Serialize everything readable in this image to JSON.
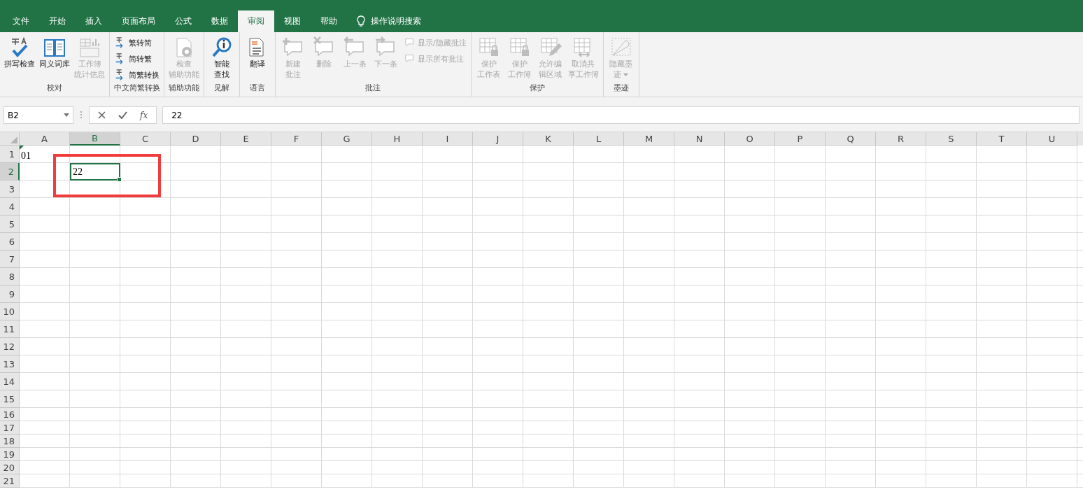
{
  "tabs": [
    {
      "label": "文件",
      "selected": false
    },
    {
      "label": "开始",
      "selected": false
    },
    {
      "label": "插入",
      "selected": false
    },
    {
      "label": "页面布局",
      "selected": false
    },
    {
      "label": "公式",
      "selected": false
    },
    {
      "label": "数据",
      "selected": false
    },
    {
      "label": "审阅",
      "selected": true
    },
    {
      "label": "视图",
      "selected": false
    },
    {
      "label": "帮助",
      "selected": false
    }
  ],
  "tell_me": {
    "placeholder": "操作说明搜索"
  },
  "ribbon_groups": [
    {
      "label": "校对",
      "items": [
        {
          "kind": "large",
          "label": "拼写检查",
          "disabled": false
        },
        {
          "kind": "large",
          "label": "同义词库",
          "disabled": false
        },
        {
          "kind": "large",
          "label": "工作簿统计信息",
          "disabled": true
        }
      ]
    },
    {
      "label": "中文简繁转换",
      "items": [
        {
          "kind": "small",
          "label": "繁转简",
          "disabled": false
        },
        {
          "kind": "small",
          "label": "简转繁",
          "disabled": false
        },
        {
          "kind": "small",
          "label": "简繁转换",
          "disabled": false
        }
      ]
    },
    {
      "label": "辅助功能",
      "items": [
        {
          "kind": "large",
          "label": "检查辅助功能",
          "disabled": true
        }
      ]
    },
    {
      "label": "见解",
      "items": [
        {
          "kind": "large",
          "label": "智能查找",
          "disabled": false
        }
      ]
    },
    {
      "label": "语言",
      "items": [
        {
          "kind": "large",
          "label": "翻译",
          "disabled": false
        }
      ]
    },
    {
      "label": "批注",
      "items": [
        {
          "kind": "large",
          "label": "新建批注",
          "disabled": true
        },
        {
          "kind": "large",
          "label": "删除",
          "disabled": true
        },
        {
          "kind": "large",
          "label": "上一条",
          "disabled": true
        },
        {
          "kind": "large",
          "label": "下一条",
          "disabled": true
        },
        {
          "kind": "small",
          "label": "显示/隐藏批注",
          "disabled": true
        },
        {
          "kind": "small",
          "label": "显示所有批注",
          "disabled": true
        }
      ]
    },
    {
      "label": "保护",
      "items": [
        {
          "kind": "large",
          "label": "保护工作表",
          "disabled": true
        },
        {
          "kind": "large",
          "label": "保护工作簿",
          "disabled": true
        },
        {
          "kind": "large",
          "label": "允许编辑区域",
          "disabled": true
        },
        {
          "kind": "large",
          "label": "取消共享工作簿",
          "disabled": true
        }
      ]
    },
    {
      "label": "墨迹",
      "items": [
        {
          "kind": "dropdown",
          "label": "隐藏墨迹",
          "disabled": true
        }
      ]
    }
  ],
  "name_box": {
    "value": "B2"
  },
  "formula_bar": {
    "function_label": "fx",
    "value": "22"
  },
  "columns": [
    "A",
    "B",
    "C",
    "D",
    "E",
    "F",
    "G",
    "H",
    "I",
    "J",
    "K",
    "L",
    "M",
    "N",
    "O",
    "P",
    "Q",
    "R",
    "S",
    "T",
    "U"
  ],
  "rows": [
    {
      "label": "1",
      "cells": [
        {
          "value": "01",
          "error_indicator": true,
          "selected": false
        }
      ]
    },
    {
      "label": "2",
      "cells": [
        {
          "selected": false
        },
        {
          "value": "22",
          "selected": true
        }
      ]
    },
    {
      "label": "3"
    },
    {
      "label": "4"
    },
    {
      "label": "5"
    },
    {
      "label": "6"
    },
    {
      "label": "7"
    },
    {
      "label": "8"
    },
    {
      "label": "9"
    },
    {
      "label": "10"
    },
    {
      "label": "11"
    },
    {
      "label": "12"
    },
    {
      "label": "13"
    },
    {
      "label": "14"
    },
    {
      "label": "15"
    },
    {
      "label": "16"
    },
    {
      "label": "17"
    },
    {
      "label": "18"
    },
    {
      "label": "19"
    },
    {
      "label": "20"
    },
    {
      "label": "21"
    }
  ]
}
